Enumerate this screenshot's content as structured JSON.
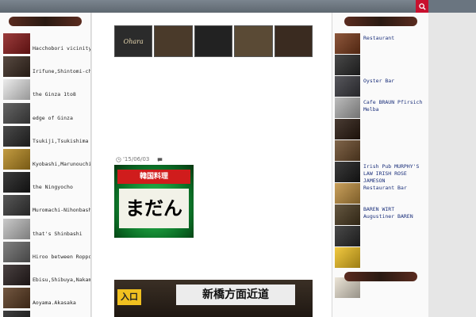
{
  "left_sidebar": {
    "heading": "",
    "items": [
      {
        "en": "Hacchobori vicinity",
        "color": "#8a1a1a"
      },
      {
        "en": "Irifune,Shintomi-cho",
        "color": "#3a2a20"
      },
      {
        "en": "the Ginza 1to8",
        "color": "#e8e8e8"
      },
      {
        "en": "edge of Ginza",
        "color": "#4a4a4a"
      },
      {
        "en": "Tsukiji,Tsukishima",
        "color": "#2a2a2a"
      },
      {
        "en": "Kyobashi,Marunouchi",
        "color": "#b88a20"
      },
      {
        "en": "the Ningyocho",
        "color": "#1a1a1a"
      },
      {
        "en": "Muromachi-Nihonbashi",
        "color": "#3a3a3a"
      },
      {
        "en": "that's Shinbashi",
        "color": "#c0c0c0"
      },
      {
        "en": "Hiroo between Roppongi",
        "color": "#6a6a6a"
      },
      {
        "en": "Ebisu,Shibuya,Nakame.",
        "color": "#2a2020"
      },
      {
        "en": "Aoyama.Akasaka",
        "color": "#5a3a20"
      },
      {
        "en": "Azabu,Shirokane",
        "color": "#1f1f1f"
      }
    ]
  },
  "main": {
    "banner_tiles": [
      "Ohara",
      "",
      "",
      "",
      ""
    ],
    "intro": "",
    "breadcrumb": "",
    "title": "",
    "date": "'15/06/03",
    "comments": "",
    "photo1_header": "韓国料理",
    "photo1_big": "まだん",
    "body_link": "",
    "body_text": "",
    "para2": "",
    "photo2_sign": "新橋方面近道",
    "photo2_left": "入口"
  },
  "right_sidebar": {
    "heading": "",
    "heading2": "",
    "items": [
      {
        "text": "Restaurant",
        "color": "#7a3a1a"
      },
      {
        "text": "",
        "color": "#2a2a2a"
      },
      {
        "text": "Oyster Bar",
        "color": "#3a3a40"
      },
      {
        "text": "Cafe BRAUN Pfirsich Melba",
        "color": "#b0b0b0"
      },
      {
        "text": "",
        "color": "#2a1a10"
      },
      {
        "text": "",
        "color": "#6a4a2a"
      },
      {
        "text": "Irish Pub MURPHY'S LAW IRISH ROSE JAMESON",
        "color": "#1a1a1a"
      },
      {
        "text": "Restaurant Bar",
        "color": "#c09040"
      },
      {
        "text": "BAREN WIRT Augustiner BAREN",
        "color": "#4a3a20"
      },
      {
        "text": "",
        "color": "#2a2a2a"
      },
      {
        "text": "",
        "color": "#f0c020"
      },
      {
        "text": "",
        "color": "#e8e0d0"
      }
    ]
  }
}
